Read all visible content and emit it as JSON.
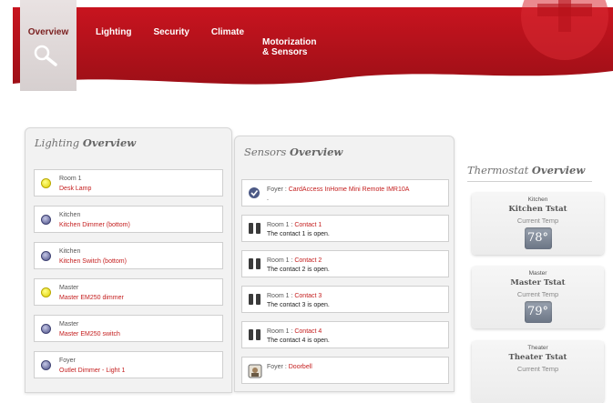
{
  "nav": {
    "items": [
      {
        "label": "Overview",
        "active": true
      },
      {
        "label": "Lighting"
      },
      {
        "label": "Security"
      },
      {
        "label": "Climate"
      },
      {
        "label": "Motorization\n& Sensors"
      }
    ],
    "search_icon": "magnifier-icon"
  },
  "colors": {
    "brand_red": "#b5121b",
    "link_red": "#c41e1e"
  },
  "lighting": {
    "title_a": "Lighting ",
    "title_b": "Overview",
    "items": [
      {
        "room": "Room 1",
        "device": "Desk Lamp",
        "state": "on"
      },
      {
        "room": "Kitchen",
        "device": "Kitchen Dimmer (bottom)",
        "state": "off"
      },
      {
        "room": "Kitchen",
        "device": "Kitchen Switch (bottom)",
        "state": "off"
      },
      {
        "room": "Master",
        "device": "Master EM250 dimmer",
        "state": "on"
      },
      {
        "room": "Master",
        "device": "Master EM250 switch",
        "state": "off"
      },
      {
        "room": "Foyer",
        "device": "Outlet Dimmer - Light 1",
        "state": "off"
      }
    ]
  },
  "sensors": {
    "title_a": "Sensors ",
    "title_b": "Overview",
    "items": [
      {
        "room": "Foyer",
        "device": "CardAccess InHome Mini Remote IMR10A",
        "status": ".",
        "icon": "remote-icon"
      },
      {
        "room": "Room 1",
        "device": "Contact 1",
        "status": "The contact 1 is open.",
        "icon": "door-contact-icon"
      },
      {
        "room": "Room 1",
        "device": "Contact 2",
        "status": "The contact 2 is open.",
        "icon": "door-contact-icon"
      },
      {
        "room": "Room 1",
        "device": "Contact 3",
        "status": "The contact 3 is open.",
        "icon": "door-contact-icon"
      },
      {
        "room": "Room 1",
        "device": "Contact 4",
        "status": "The contact 4 is open.",
        "icon": "door-contact-icon"
      },
      {
        "room": "Foyer",
        "device": "Doorbell",
        "status": "",
        "icon": "doorbell-icon"
      }
    ]
  },
  "thermostat": {
    "title_a": "Thermostat ",
    "title_b": "Overview",
    "items": [
      {
        "room": "Kitchen",
        "name": "Kitchen Tstat",
        "label": "Current Temp",
        "temp": "78°"
      },
      {
        "room": "Master",
        "name": "Master Tstat",
        "label": "Current Temp",
        "temp": "79°"
      },
      {
        "room": "Theater",
        "name": "Theater Tstat",
        "label": "Current Temp",
        "temp": ""
      }
    ]
  }
}
